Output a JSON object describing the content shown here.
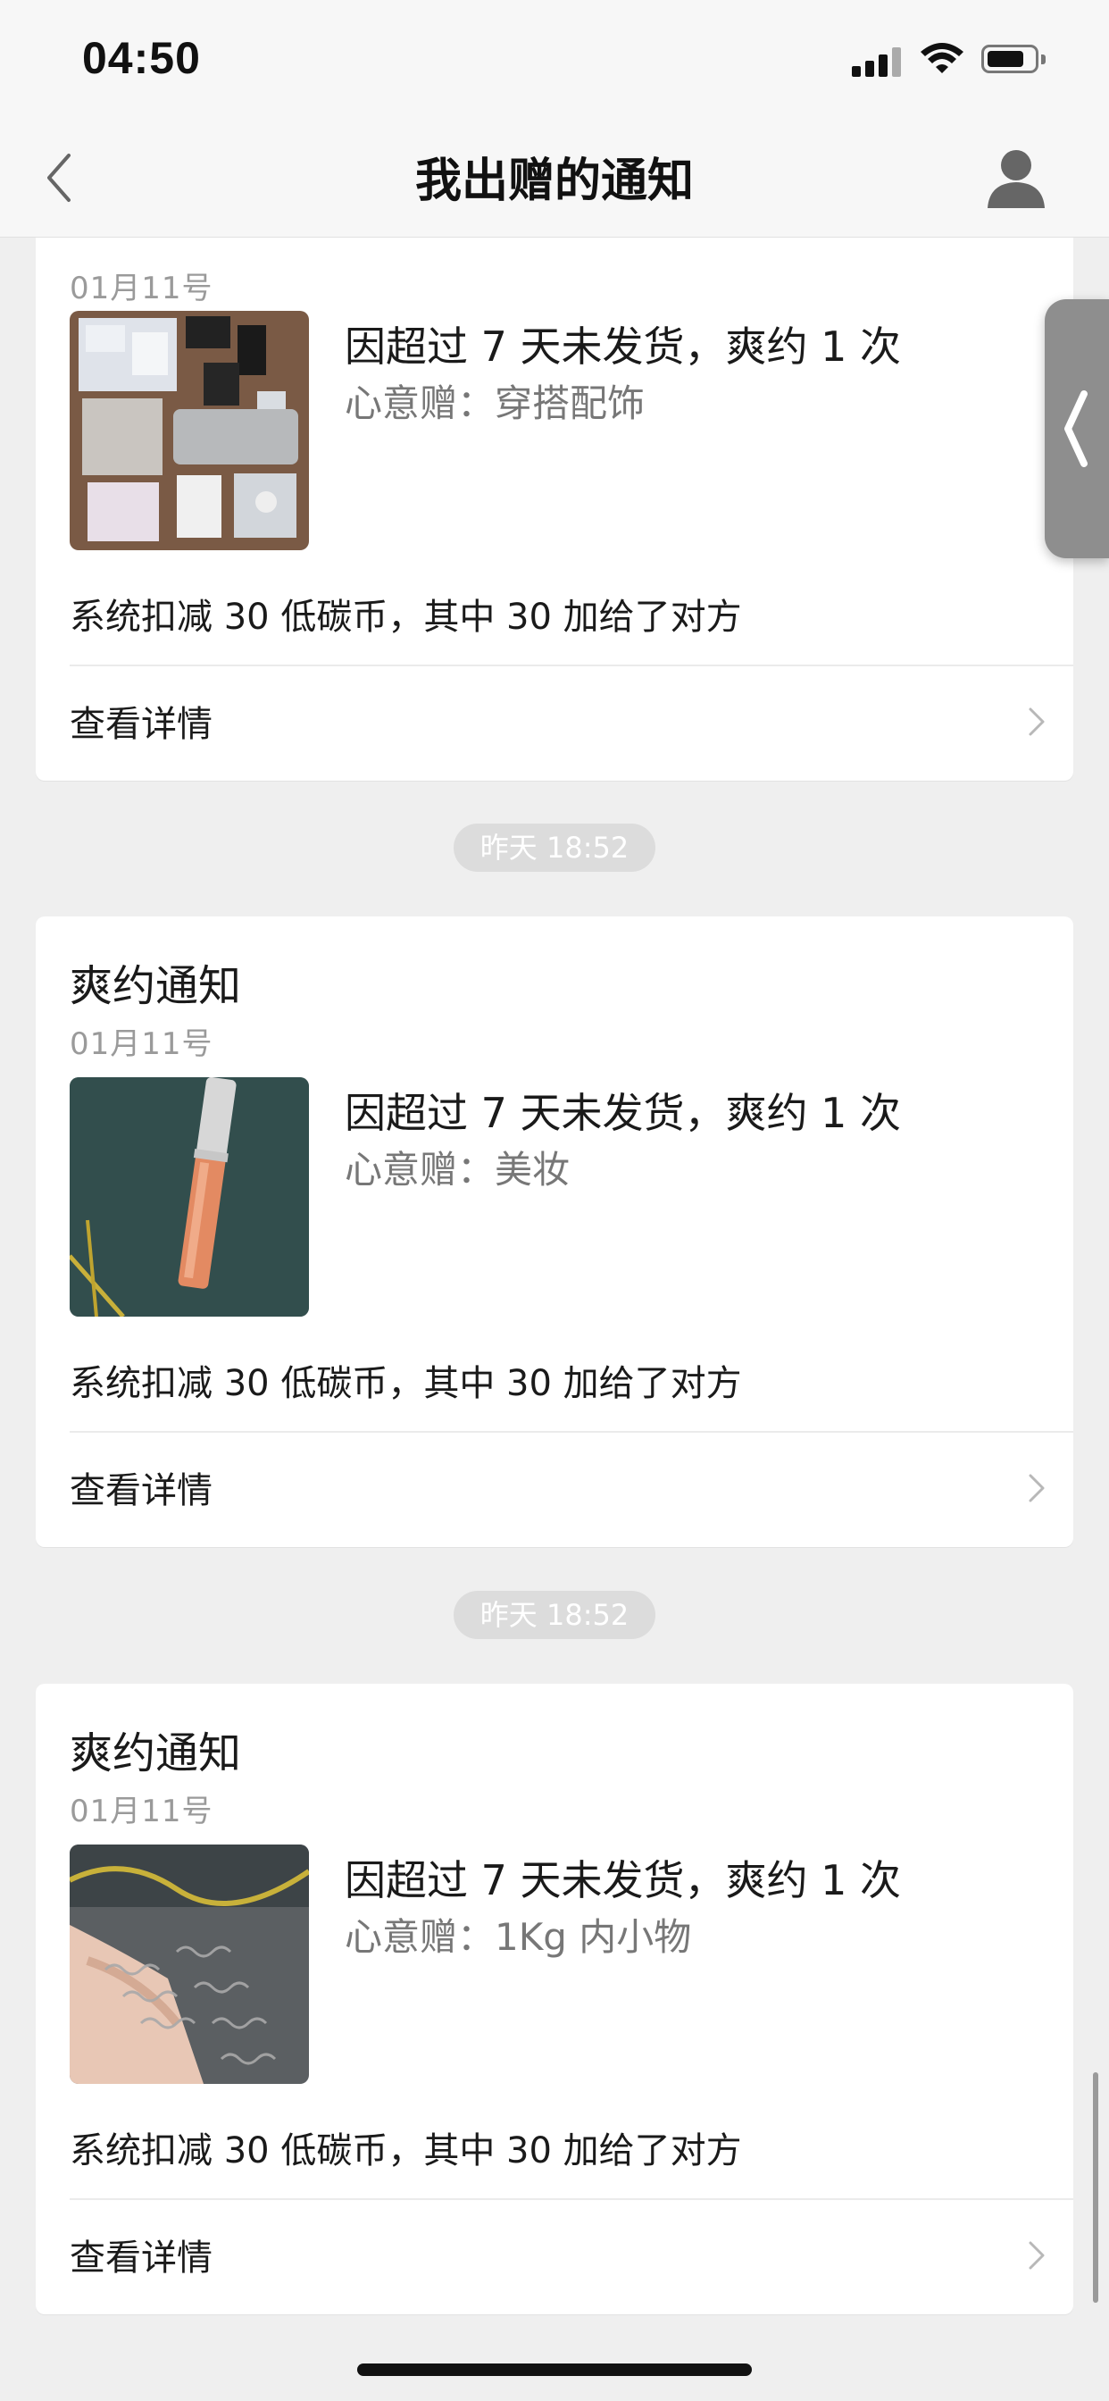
{
  "status_bar": {
    "time": "04:50"
  },
  "nav": {
    "title": "我出赠的通知"
  },
  "cards": [
    {
      "title": "",
      "date": "01月11号",
      "notice": "因超过 7 天未发货，爽约 1 次",
      "category": "心意赠：穿搭配饰",
      "deduction": "系统扣减 30 低碳币，其中 30 加给了对方",
      "detail_label": "查看详情"
    },
    {
      "title": "爽约通知",
      "date": "01月11号",
      "notice": "因超过 7 天未发货，爽约 1 次",
      "category": "心意赠：美妆",
      "deduction": "系统扣减 30 低碳币，其中 30 加给了对方",
      "detail_label": "查看详情"
    },
    {
      "title": "爽约通知",
      "date": "01月11号",
      "notice": "因超过 7 天未发货，爽约 1 次",
      "category": "心意赠：1Kg 内小物",
      "deduction": "系统扣减 30 低碳币，其中 30 加给了对方",
      "detail_label": "查看详情"
    }
  ],
  "time_separators": [
    "昨天 18:52",
    "昨天 18:52"
  ]
}
